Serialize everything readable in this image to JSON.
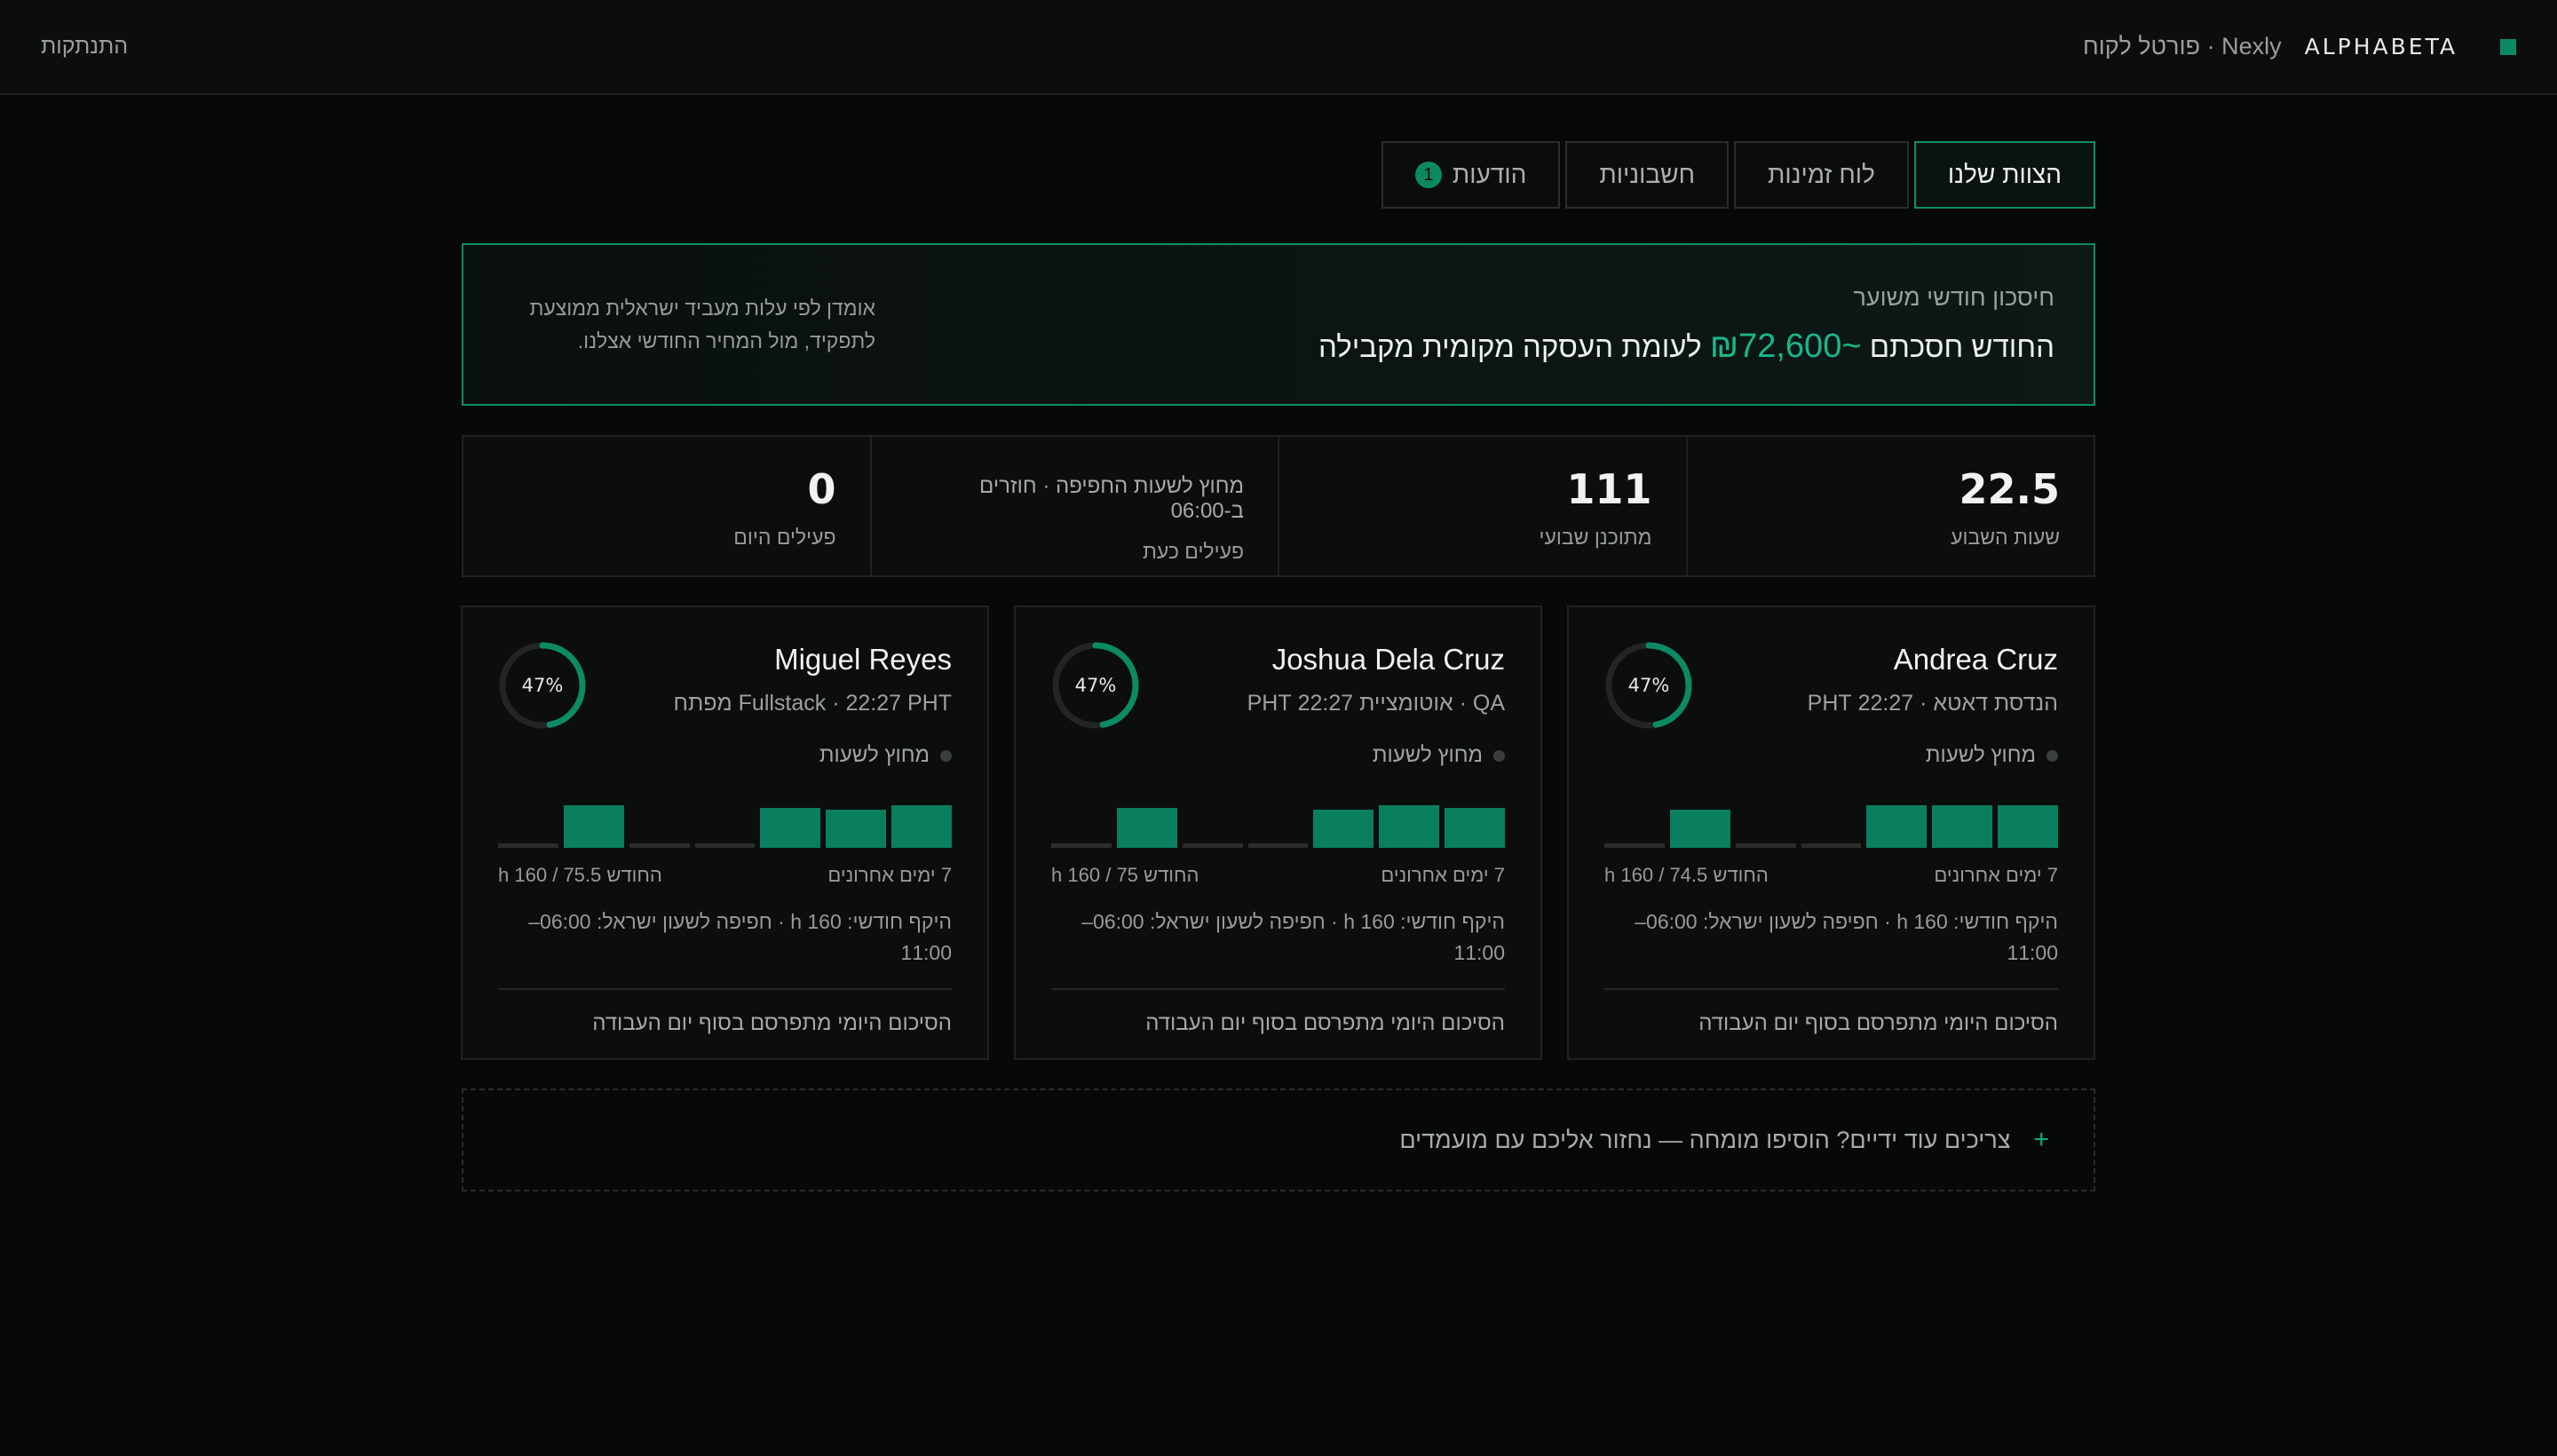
{
  "header": {
    "brand_name": "ALPHABETA",
    "brand_sub": "Nexly · פורטל לקוח",
    "logout": "התנתקות",
    "brand_color": "#0c8a63"
  },
  "tabs": [
    {
      "label": "הצוות שלנו",
      "active": true
    },
    {
      "label": "לוח זמינות",
      "active": false
    },
    {
      "label": "חשבוניות",
      "active": false
    },
    {
      "label": "הודעות",
      "badge": "1",
      "active": false
    }
  ],
  "savings": {
    "label": "חיסכון חודשי משוער",
    "line_prefix": "החודש חסכתם",
    "amount": "~₪72,600",
    "line_suffix": "לעומת העסקה מקומית מקבילה",
    "note": "אומדן לפי עלות מעביד ישראלית ממוצעת לתפקיד, מול המחיר החודשי אצלנו."
  },
  "stats": {
    "week_hours_value": "22.5",
    "week_hours_label": "שעות השבוע",
    "planned_value": "111",
    "planned_label": "מתוכנן שבועי",
    "offhours_text": "מחוץ לשעות החפיפה · חוזרים ב-06:00",
    "active_now_label": "פעילים כעת",
    "active_today_value": "0",
    "active_today_label": "פעילים היום"
  },
  "cards": [
    {
      "name": "Andrea Cruz",
      "role": "הנדסת דאטא · 22:27 PHT",
      "ring": "47%",
      "ring_fraction": 0.47,
      "status": "מחוץ לשעות",
      "bars": [
        0.8,
        0.8,
        0.8,
        0,
        0,
        0.72,
        0
      ],
      "last7": "7 ימים אחרונים",
      "monthly": "החודש 74.5 / 160 h",
      "scope": "היקף חודשי: 160 h · חפיפה לשעון ישראל: 06:00–11:00",
      "footer": "הסיכום היומי מתפרסם בסוף יום העבודה"
    },
    {
      "name": "Joshua Dela Cruz",
      "role": "QA · אוטומציית 22:27 PHT",
      "ring": "47%",
      "ring_fraction": 0.47,
      "status": "מחוץ לשעות",
      "bars": [
        0.75,
        0.8,
        0.72,
        0,
        0,
        0.75,
        0
      ],
      "last7": "7 ימים אחרונים",
      "monthly": "החודש 75 / 160 h",
      "scope": "היקף חודשי: 160 h · חפיפה לשעון ישראל: 06:00–11:00",
      "footer": "הסיכום היומי מתפרסם בסוף יום העבודה"
    },
    {
      "name": "Miguel Reyes",
      "role": "Fullstack · 22:27 PHT מפתח",
      "ring": "47%",
      "ring_fraction": 0.47,
      "status": "מחוץ לשעות",
      "bars": [
        0.8,
        0.72,
        0.75,
        0,
        0,
        0.8,
        0
      ],
      "last7": "7 ימים אחרונים",
      "monthly": "החודש 75.5 / 160 h",
      "scope": "היקף חודשי: 160 h · חפיפה לשעון ישראל: 06:00–11:00",
      "footer": "הסיכום היומי מתפרסם בסוף יום העבודה"
    }
  ],
  "add_more": {
    "icon": "plus-icon",
    "text": "צריכים עוד ידיים? הוסיפו מומחה — נחזור אליכם עם מועמדים"
  }
}
